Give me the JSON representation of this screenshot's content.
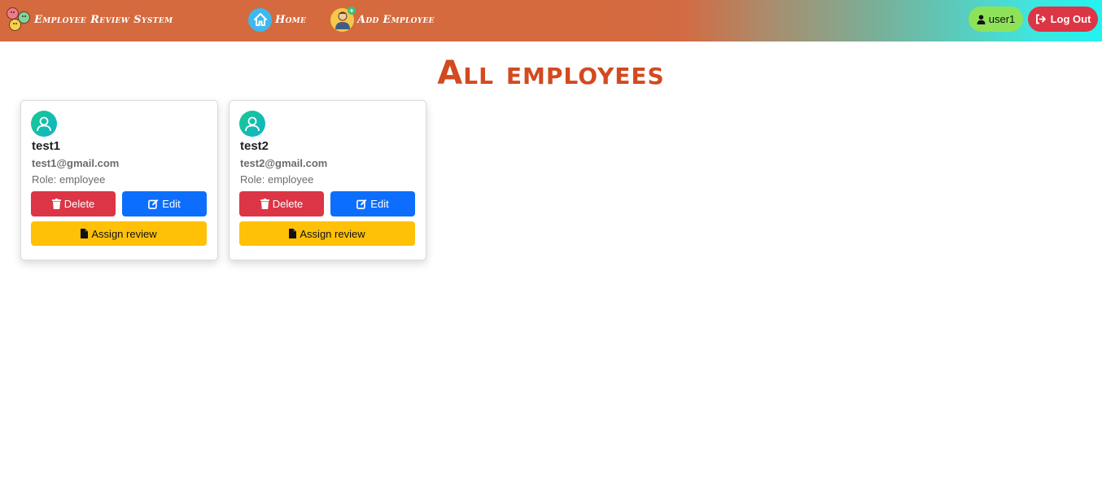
{
  "navbar": {
    "brand": "Employee Review System",
    "home_label": "Home",
    "add_employee_label": "Add Employee",
    "user_label": "user1",
    "logout_label": "Log Out"
  },
  "page": {
    "title": "All employees"
  },
  "employees": [
    {
      "name": "test1",
      "email": "test1@gmail.com",
      "role": "Role: employee",
      "delete_label": "Delete",
      "edit_label": "Edit",
      "assign_label": "Assign review"
    },
    {
      "name": "test2",
      "email": "test2@gmail.com",
      "role": "Role: employee",
      "delete_label": "Delete",
      "edit_label": "Edit",
      "assign_label": "Assign review"
    }
  ],
  "icons": {
    "brand": "emoji-faces-icon",
    "home": "house-icon",
    "add_employee": "person-plus-icon",
    "user": "user-icon",
    "logout": "sign-out-icon",
    "avatar": "user-circle-icon",
    "delete": "trash-icon",
    "edit": "edit-icon",
    "assign": "file-icon"
  },
  "colors": {
    "title": "#d24a1f",
    "delete": "#dc3545",
    "edit": "#0d6efd",
    "assign": "#ffc107",
    "user_badge": "#8ee25a"
  }
}
